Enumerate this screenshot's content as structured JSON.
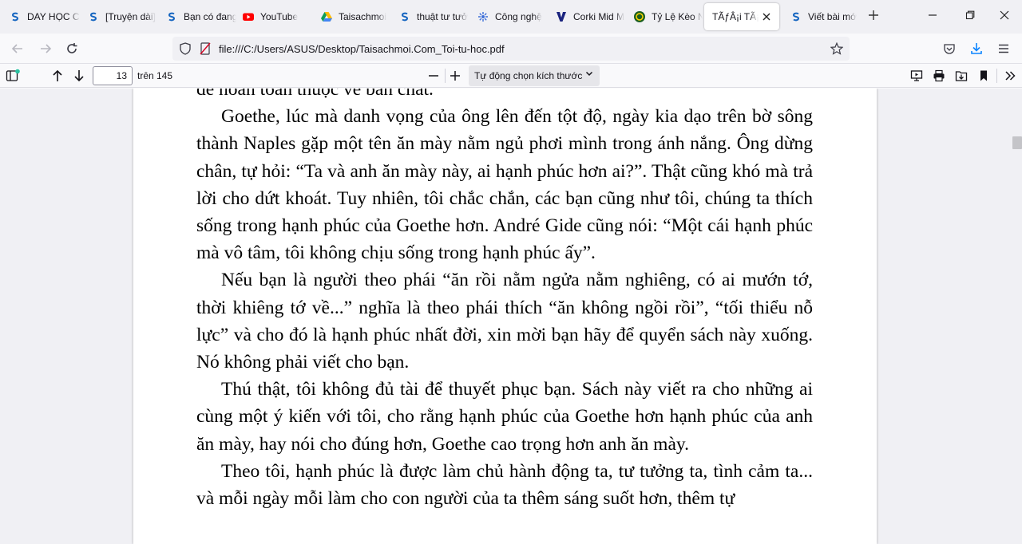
{
  "tabs": [
    {
      "label": "DAY HỌC C",
      "icon": "s-logo-icon"
    },
    {
      "label": "[Truyện dài]",
      "icon": "s-logo-icon"
    },
    {
      "label": "Bạn có đang",
      "icon": "s-logo-icon"
    },
    {
      "label": "YouTube",
      "icon": "youtube-icon"
    },
    {
      "label": "Taisachmoi",
      "icon": "google-drive-icon"
    },
    {
      "label": "thuật tư tưở",
      "icon": "s-logo-icon"
    },
    {
      "label": "Công nghệ",
      "icon": "app-icon"
    },
    {
      "label": "Corki Mid M",
      "icon": "v-logo-icon"
    },
    {
      "label": "Tỷ Lệ Kèo N",
      "icon": "green-logo-icon"
    },
    {
      "label": "TÃƒÂ¡i TÃ¡»",
      "icon": "none",
      "active": true
    },
    {
      "label": "Viết bài mớ",
      "icon": "s-logo-icon"
    }
  ],
  "address": {
    "url": "file:///C:/Users/ASUS/Desktop/Taisachmoi.Com_Toi-tu-hoc.pdf"
  },
  "pdf_toolbar": {
    "current_page": "13",
    "total_pages": "trên 145",
    "zoom": "Tự động chọn kích thước"
  },
  "document": {
    "partial_top_line": "để hoàn toàn thuộc về bản chất.",
    "paragraphs": [
      "Goethe, lúc mà danh vọng của ông lên đến tột độ, ngày kia dạo trên bờ sông thành Naples gặp một tên ăn mày nằm ngủ phơi mình trong ánh nắng. Ông dừng chân, tự hỏi: “Ta và anh ăn mày này, ai hạnh phúc hơn ai?”. Thật cũng khó mà trả lời cho dứt khoát. Tuy nhiên, tôi chắc chắn, các bạn cũng như tôi, chúng ta thích sống trong hạnh phúc của Goethe hơn. André Gide cũng nói: “Một cái hạnh phúc mà vô tâm, tôi không chịu sống trong hạnh phúc ấy”.",
      "Nếu bạn là người theo phái “ăn rồi nằm ngửa nằm nghiêng, có ai mướn tớ, thời khiêng tớ về...” nghĩa là theo phái thích “ăn không ngồi rồi”, “tối thiểu nỗ lực” và cho đó là hạnh phúc nhất đời, xin mời bạn hãy để quyển sách này xuống. Nó không phải viết cho bạn.",
      "Thú thật, tôi không đủ tài để thuyết phục bạn. Sách này viết ra cho những ai cùng một ý kiến với tôi, cho rằng hạnh phúc của Goethe hơn hạnh phúc của anh ăn mày, hay nói cho đúng hơn, Goethe cao trọng hơn anh ăn mày.",
      "Theo tôi, hạnh phúc là được làm chủ hành động ta, tư tưởng ta, tình cảm ta... và mỗi ngày mỗi làm cho con người của ta thêm sáng suốt hơn, thêm tự"
    ]
  }
}
